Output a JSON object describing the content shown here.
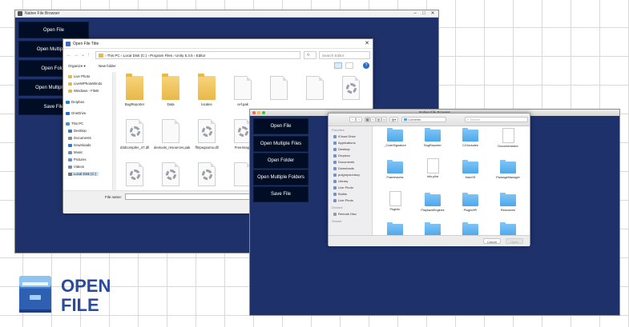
{
  "left_window": {
    "title": "Native File Browser",
    "buttons": [
      "Open File",
      "Open Multiple F",
      "Open Folde",
      "Open Multiple Fo",
      "Save File"
    ]
  },
  "win_dialog": {
    "title": "Open File Title",
    "breadcrumb": "› This PC › Local Disk (C:) › Program Files › Unity 5.3.5 › Editor",
    "search_placeholder": "Search Editor",
    "organize": "Organize ▾",
    "new_folder": "New folder",
    "nav": [
      "Live Photo",
      "LiveWPhotoWindo",
      "Windows - FileB",
      "Dropbox",
      "OneDrive",
      "This PC",
      "Desktop",
      "Documents",
      "Downloads",
      "Music",
      "Pictures",
      "Videos",
      "Local Disk (C:)"
    ],
    "files": [
      {
        "name": "BugReporter",
        "kind": "folder"
      },
      {
        "name": "Data",
        "kind": "folder"
      },
      {
        "name": "locales",
        "kind": "folder"
      },
      {
        "name": "cef.pak",
        "kind": "page"
      },
      {
        "name": "",
        "kind": "page"
      },
      {
        "name": "",
        "kind": "page"
      },
      {
        "name": "",
        "kind": "gear"
      },
      {
        "name": "d3dcompiler_47.dll",
        "kind": "gear"
      },
      {
        "name": "devtools_resources.pak",
        "kind": "page"
      },
      {
        "name": "ffmpegsumo.dll",
        "kind": "gear"
      },
      {
        "name": "FreeImage",
        "kind": "gear"
      },
      {
        "name": "",
        "kind": "gear"
      },
      {
        "name": "",
        "kind": "gear"
      },
      {
        "name": "",
        "kind": "gear"
      },
      {
        "name": "",
        "kind": "page"
      }
    ],
    "filename_label": "File name:"
  },
  "right_window": {
    "title": "Native File Browser",
    "buttons": [
      "Open File",
      "Open Multiple Files",
      "Open Folder",
      "Open Multiple Folders",
      "Save File"
    ]
  },
  "mac_dialog": {
    "location": "Contents",
    "search_placeholder": "Search",
    "sidebar_headers": [
      "Favorites",
      "Devices",
      "Shared"
    ],
    "favorites": [
      "iCloud Drive",
      "Applications",
      "Desktop",
      "Dropbox",
      "Documents",
      "Downloads",
      "pulgmymonkey",
      "Library",
      "Live Photo",
      "Builds",
      "Live Photo"
    ],
    "devices": [
      "Remote Disc"
    ],
    "files": [
      {
        "name": "_CodeSignature",
        "kind": "folder"
      },
      {
        "name": "BugReporter",
        "kind": "folder"
      },
      {
        "name": "CGIncludes",
        "kind": "folder"
      },
      {
        "name": "Documentation",
        "kind": "page"
      },
      {
        "name": "Frameworks",
        "kind": "folder"
      },
      {
        "name": "Info.plist",
        "kind": "page"
      },
      {
        "name": "MacOS",
        "kind": "folder"
      },
      {
        "name": "PackageManager",
        "kind": "folder"
      },
      {
        "name": "PkgInfo",
        "kind": "page"
      },
      {
        "name": "PlaybackEngines",
        "kind": "folder"
      },
      {
        "name": "PluginAPI",
        "kind": "folder"
      },
      {
        "name": "Resources",
        "kind": "folder"
      },
      {
        "name": "",
        "kind": "folder"
      },
      {
        "name": "",
        "kind": "folder"
      },
      {
        "name": "",
        "kind": "folder"
      },
      {
        "name": "",
        "kind": "folder"
      }
    ],
    "cancel": "Cancel",
    "open": "Open"
  },
  "logo": {
    "line1": "OPEN",
    "line2": "FILE"
  },
  "colors": {
    "unity_bg": "#1e316b",
    "button_bg": "#000d24",
    "logo": "#2b4a99"
  }
}
